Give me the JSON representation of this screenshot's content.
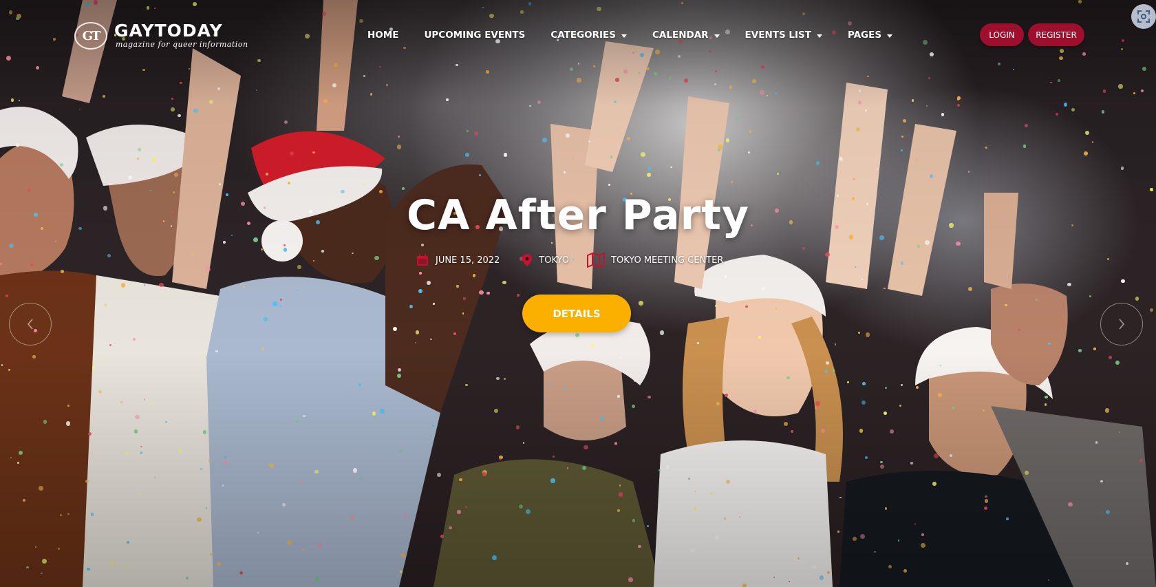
{
  "site": {
    "logo_mark": "GT",
    "name": "GAYTODAY",
    "tagline": "magazine for queer information"
  },
  "nav": {
    "items": [
      {
        "label": "HOME",
        "has_dropdown": false
      },
      {
        "label": "UPCOMING EVENTS",
        "has_dropdown": false
      },
      {
        "label": "CATEGORIES",
        "has_dropdown": true
      },
      {
        "label": "CALENDAR",
        "has_dropdown": true
      },
      {
        "label": "EVENTS LIST",
        "has_dropdown": true
      },
      {
        "label": "PAGES",
        "has_dropdown": true
      }
    ]
  },
  "auth": {
    "login_label": "LOGIN",
    "register_label": "REGISTER"
  },
  "hero": {
    "title": "CA After Party",
    "date": "JUNE 15, 2022",
    "location": "TOKYO",
    "venue": "TOKYO MEETING CENTER",
    "details_label": "DETAILS"
  },
  "icons": {
    "date": "calendar-icon",
    "location": "map-pin-icon",
    "venue": "map-icon",
    "prev": "chevron-left-icon",
    "next": "chevron-right-icon",
    "scan": "scan-icon"
  },
  "colors": {
    "accent_red": "#9d0f2c",
    "details_yellow": "#fbb000",
    "meta_icon_red": "#c4122f"
  }
}
